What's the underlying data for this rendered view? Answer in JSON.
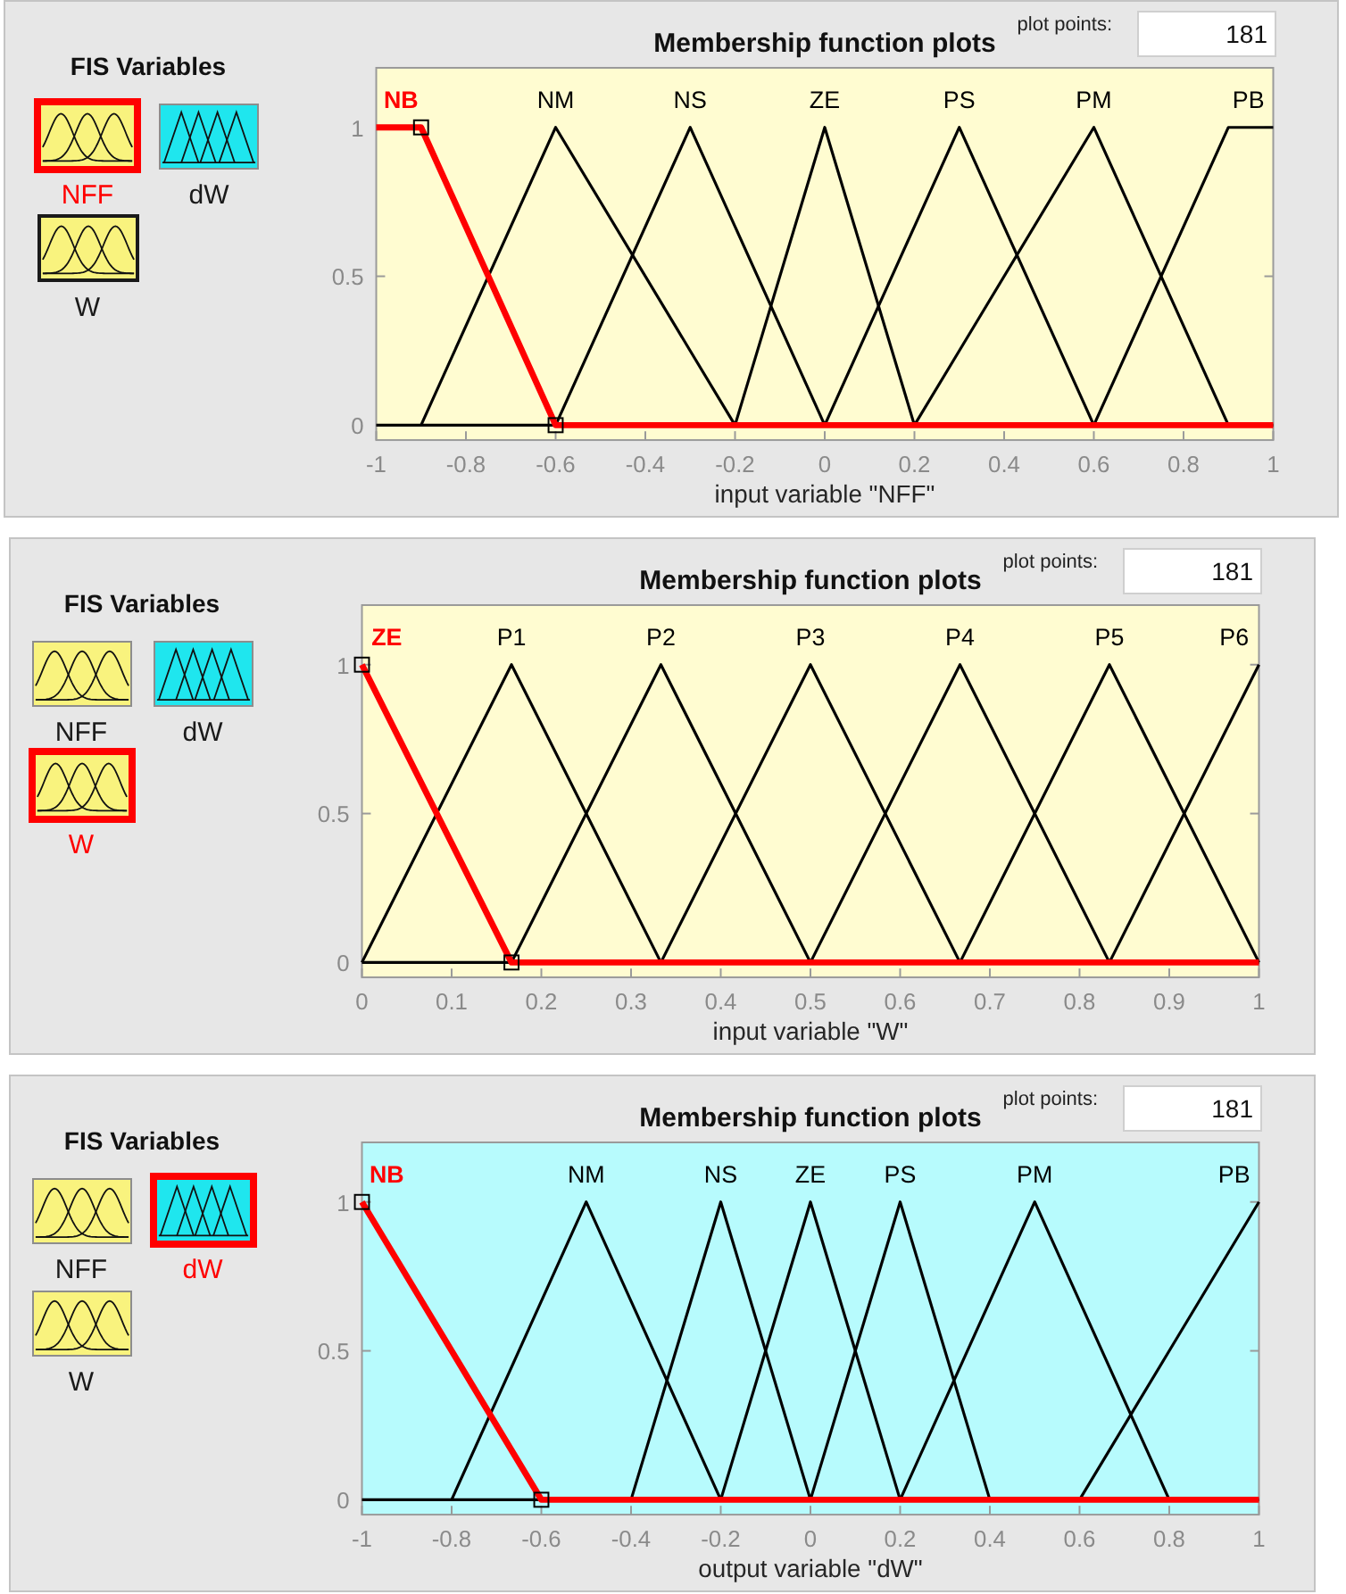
{
  "panels": [
    {
      "fis_variables": {
        "title": "FIS Variables",
        "variables": [
          {
            "name": "NFF",
            "kind": "input",
            "selected": true,
            "focused": false
          },
          {
            "name": "dW",
            "kind": "output",
            "selected": false,
            "focused": false
          },
          {
            "name": "W",
            "kind": "input",
            "selected": false,
            "focused": true
          }
        ]
      },
      "plot_points": {
        "label": "plot points:",
        "value": "181"
      },
      "chart_data": {
        "type": "line",
        "title": "Membership function plots",
        "xlabel": "input variable \"NFF\"",
        "x": [
          -1,
          -0.9,
          -0.6,
          -0.3,
          -0.2,
          0,
          0.2,
          0.3,
          0.6,
          0.9,
          1
        ],
        "xlim": [
          -1,
          1
        ],
        "ylim": [
          -0.05,
          1.2
        ],
        "xticks": [
          -1,
          -0.8,
          -0.6,
          -0.4,
          -0.2,
          0,
          0.2,
          0.4,
          0.6,
          0.8,
          1
        ],
        "yticks": [
          0,
          0.5,
          1
        ],
        "series": [
          {
            "name": "NB",
            "color": "#ff0000",
            "values": [
              1,
              1,
              0,
              0,
              0,
              0,
              0,
              0,
              0,
              0,
              0
            ]
          },
          {
            "name": "NM",
            "color": "#000000",
            "values": [
              null,
              0,
              1,
              0.25,
              0,
              null,
              null,
              null,
              null,
              null,
              null
            ]
          },
          {
            "name": "NS",
            "color": "#000000",
            "values": [
              null,
              null,
              0,
              1,
              0.667,
              0,
              null,
              null,
              null,
              null,
              null
            ]
          },
          {
            "name": "ZE",
            "color": "#000000",
            "values": [
              null,
              null,
              null,
              null,
              0,
              1,
              0,
              null,
              null,
              null,
              null
            ]
          },
          {
            "name": "PS",
            "color": "#000000",
            "values": [
              null,
              null,
              null,
              null,
              null,
              0,
              0.667,
              1,
              0,
              null,
              null
            ]
          },
          {
            "name": "PM",
            "color": "#000000",
            "values": [
              null,
              null,
              null,
              null,
              null,
              null,
              0,
              0.25,
              1,
              0,
              null
            ]
          },
          {
            "name": "PB",
            "color": "#000000",
            "values": [
              null,
              null,
              null,
              null,
              null,
              null,
              null,
              null,
              0,
              1,
              1
            ]
          }
        ]
      }
    },
    {
      "fis_variables": {
        "title": "FIS Variables",
        "variables": [
          {
            "name": "NFF",
            "kind": "input",
            "selected": false,
            "focused": false
          },
          {
            "name": "dW",
            "kind": "output",
            "selected": false,
            "focused": false
          },
          {
            "name": "W",
            "kind": "input",
            "selected": true,
            "focused": false
          }
        ]
      },
      "plot_points": {
        "label": "plot points:",
        "value": "181"
      },
      "chart_data": {
        "type": "line",
        "title": "Membership function plots",
        "xlabel": "input variable \"W\"",
        "x": [
          0,
          0.1667,
          0.3333,
          0.5,
          0.6667,
          0.8333,
          1
        ],
        "xlim": [
          0,
          1
        ],
        "ylim": [
          -0.05,
          1.2
        ],
        "xticks": [
          0,
          0.1,
          0.2,
          0.3,
          0.4,
          0.5,
          0.6,
          0.7,
          0.8,
          0.9,
          1
        ],
        "yticks": [
          0,
          0.5,
          1
        ],
        "series": [
          {
            "name": "ZE",
            "color": "#ff0000",
            "values": [
              1,
              0,
              0,
              0,
              0,
              0,
              0
            ]
          },
          {
            "name": "P1",
            "color": "#000000",
            "values": [
              0,
              1,
              0,
              null,
              null,
              null,
              null
            ]
          },
          {
            "name": "P2",
            "color": "#000000",
            "values": [
              null,
              0,
              1,
              0,
              null,
              null,
              null
            ]
          },
          {
            "name": "P3",
            "color": "#000000",
            "values": [
              null,
              null,
              0,
              1,
              0,
              null,
              null
            ]
          },
          {
            "name": "P4",
            "color": "#000000",
            "values": [
              null,
              null,
              null,
              0,
              1,
              0,
              null
            ]
          },
          {
            "name": "P5",
            "color": "#000000",
            "values": [
              null,
              null,
              null,
              null,
              0,
              1,
              0
            ]
          },
          {
            "name": "P6",
            "color": "#000000",
            "values": [
              null,
              null,
              null,
              null,
              null,
              0,
              1
            ]
          }
        ]
      }
    },
    {
      "fis_variables": {
        "title": "FIS Variables",
        "variables": [
          {
            "name": "NFF",
            "kind": "input",
            "selected": false,
            "focused": false
          },
          {
            "name": "dW",
            "kind": "output",
            "selected": true,
            "focused": false
          },
          {
            "name": "W",
            "kind": "input",
            "selected": false,
            "focused": false
          }
        ]
      },
      "plot_points": {
        "label": "plot points:",
        "value": "181"
      },
      "chart_data": {
        "type": "line",
        "title": "Membership function plots",
        "xlabel": "output variable \"dW\"",
        "x": [
          -1,
          -0.8,
          -0.6,
          -0.5,
          -0.4,
          -0.2,
          0,
          0.2,
          0.4,
          0.5,
          0.6,
          0.8,
          1
        ],
        "xlim": [
          -1,
          1
        ],
        "ylim": [
          -0.05,
          1.2
        ],
        "xticks": [
          -1,
          -0.8,
          -0.6,
          -0.4,
          -0.2,
          0,
          0.2,
          0.4,
          0.6,
          0.8,
          1
        ],
        "yticks": [
          0,
          0.5,
          1
        ],
        "series": [
          {
            "name": "NB",
            "color": "#ff0000",
            "values": [
              1,
              0.5,
              0,
              0,
              0,
              0,
              0,
              0,
              0,
              0,
              0,
              0,
              0
            ]
          },
          {
            "name": "NM",
            "color": "#000000",
            "values": [
              null,
              0,
              0.667,
              1,
              0.667,
              0,
              null,
              null,
              null,
              null,
              null,
              null,
              null
            ]
          },
          {
            "name": "NS",
            "color": "#000000",
            "values": [
              null,
              null,
              null,
              null,
              0,
              1,
              0,
              null,
              null,
              null,
              null,
              null,
              null
            ]
          },
          {
            "name": "ZE",
            "color": "#000000",
            "values": [
              null,
              null,
              null,
              null,
              null,
              0,
              1,
              0,
              null,
              null,
              null,
              null,
              null
            ]
          },
          {
            "name": "PS",
            "color": "#000000",
            "values": [
              null,
              null,
              null,
              null,
              null,
              null,
              0,
              1,
              0,
              null,
              null,
              null,
              null
            ]
          },
          {
            "name": "PM",
            "color": "#000000",
            "values": [
              null,
              null,
              null,
              null,
              null,
              null,
              null,
              0,
              0.667,
              1,
              0.667,
              0,
              null
            ]
          },
          {
            "name": "PB",
            "color": "#000000",
            "values": [
              null,
              null,
              null,
              null,
              null,
              null,
              null,
              null,
              null,
              null,
              0,
              0.5,
              1
            ]
          }
        ]
      }
    }
  ]
}
